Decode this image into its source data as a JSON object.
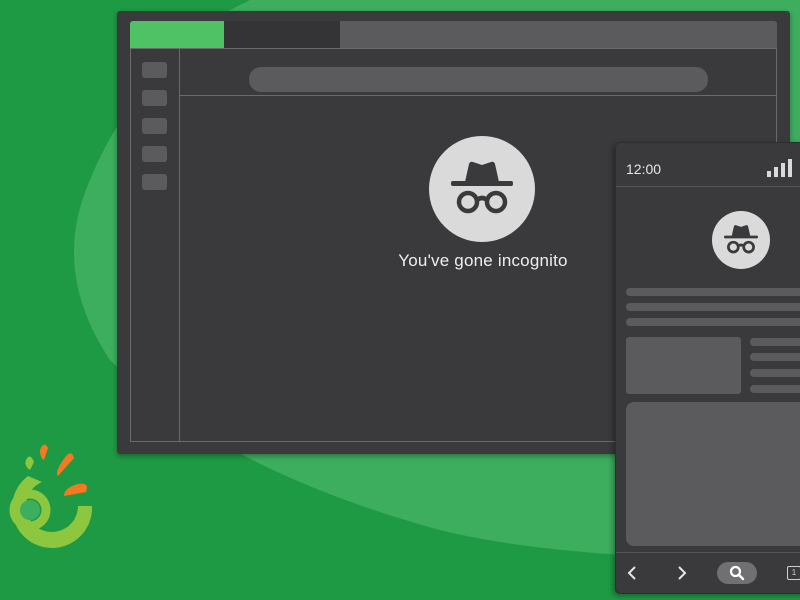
{
  "colors": {
    "background_green": "#1f9a44",
    "blob_green": "#3dae5e",
    "window_dark": "#3a3a3d",
    "element_gray": "#5b5b5e",
    "active_tab_green": "#4fc266",
    "logo_green": "#8dc63f",
    "logo_orange": "#f47920"
  },
  "browser": {
    "incognito_message": "You've gone incognito",
    "incognito_icon": "incognito-hat-glasses"
  },
  "phone": {
    "status_time": "12:00",
    "signal_icon": "cellular-signal",
    "nav": {
      "back_icon": "chevron-left",
      "forward_icon": "chevron-right",
      "search_icon": "magnifier",
      "tabs_count": "1"
    }
  },
  "logo": {
    "name": "brand-logo"
  }
}
